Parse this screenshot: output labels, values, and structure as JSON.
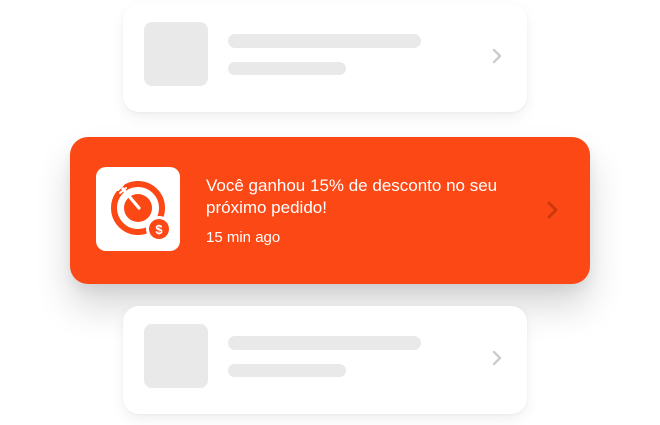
{
  "notification": {
    "title": "Você ganhou 15% de desconto no seu próximo pedido!",
    "time": "15 min ago",
    "app_icon": "food-delivery-discount-icon",
    "accent_color": "#fb4815"
  },
  "placeholders": [
    {
      "state": "loading"
    },
    {
      "state": "loading"
    }
  ],
  "icons": {
    "chevron": "chevron-right-icon"
  }
}
